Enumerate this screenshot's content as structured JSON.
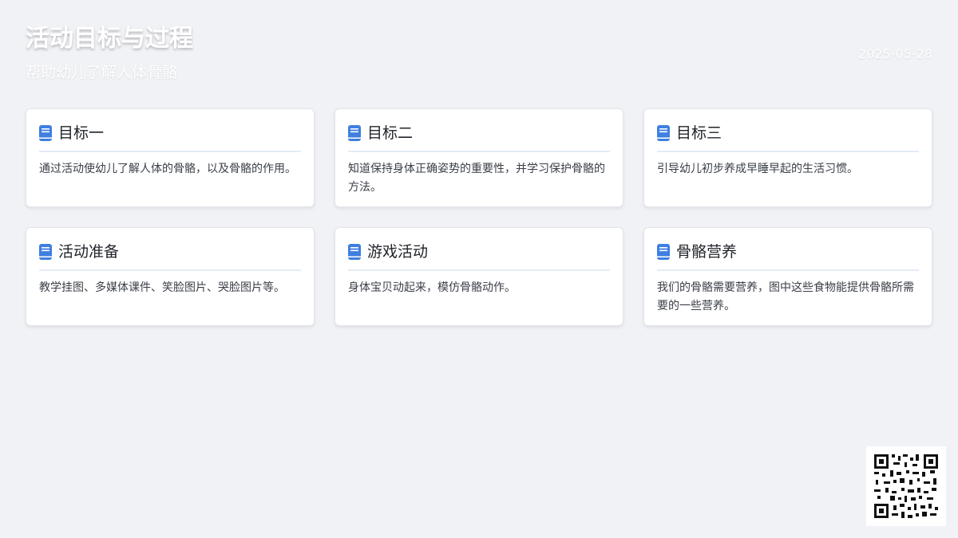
{
  "header": {
    "title": "活动目标与过程",
    "subtitle": "帮助幼儿了解人体骨骼",
    "date": "2025-05-28"
  },
  "cards": [
    {
      "title": "目标一",
      "icon": "book-icon",
      "body": "通过活动使幼儿了解人体的骨骼，以及骨骼的作用。"
    },
    {
      "title": "目标二",
      "icon": "book-icon",
      "body": "知道保持身体正确姿势的重要性，并学习保护骨骼的方法。"
    },
    {
      "title": "目标三",
      "icon": "book-icon",
      "body": "引导幼儿初步养成早睡早起的生活习惯。"
    },
    {
      "title": "活动准备",
      "icon": "book-icon",
      "body": "教学挂图、多媒体课件、笑脸图片、哭脸图片等。"
    },
    {
      "title": "游戏活动",
      "icon": "book-icon",
      "body": "身体宝贝动起来，模仿骨骼动作。"
    },
    {
      "title": "骨骼营养",
      "icon": "book-icon",
      "body": "我们的骨骼需要营养，图中这些食物能提供骨骼所需要的一些营养。"
    }
  ],
  "colors": {
    "background": "#f1f2f6",
    "accent": "#3f7fe0",
    "divider": "#e3ebf7"
  },
  "qr_code": {
    "icon": "qr-code-icon"
  }
}
